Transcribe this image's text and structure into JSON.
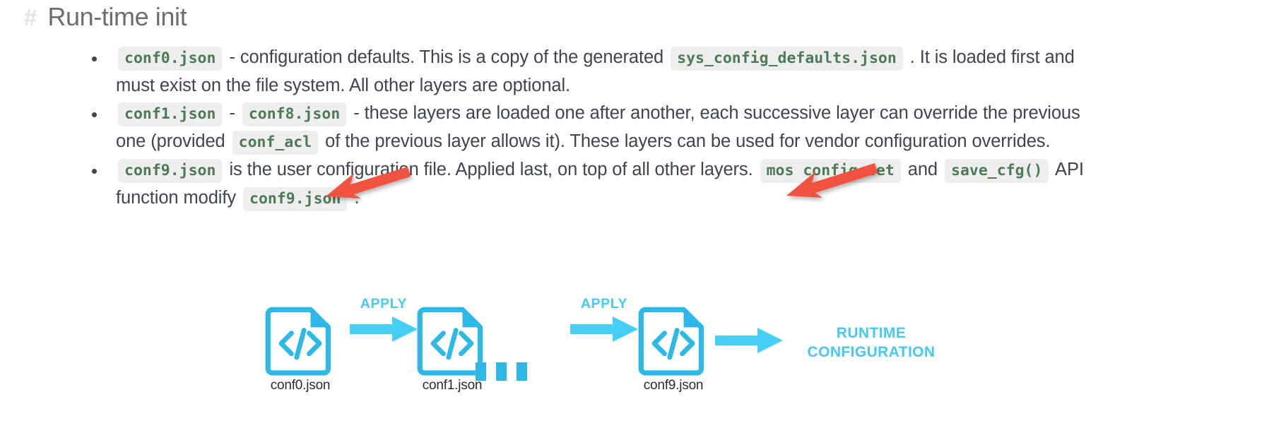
{
  "heading": {
    "anchor": "#",
    "title": "Run-time init"
  },
  "bullets": [
    {
      "id": "bullet-conf0",
      "parts": [
        {
          "type": "code",
          "text": "conf0.json"
        },
        {
          "type": "text",
          "text": " - configuration defaults. This is a copy of the generated "
        },
        {
          "type": "code",
          "text": "sys_config_defaults.json"
        },
        {
          "type": "text",
          "text": " . It is loaded first and must exist on the file system. All other layers are optional."
        }
      ]
    },
    {
      "id": "bullet-conf1-conf8",
      "parts": [
        {
          "type": "code",
          "text": "conf1.json"
        },
        {
          "type": "text",
          "text": " - "
        },
        {
          "type": "code",
          "text": "conf8.json"
        },
        {
          "type": "text",
          "text": " - these layers are loaded one after another, each successive layer can override the previous one (provided "
        },
        {
          "type": "code",
          "text": "conf_acl"
        },
        {
          "type": "text",
          "text": " of the previous layer allows it). These layers can be used for vendor configuration overrides."
        }
      ]
    },
    {
      "id": "bullet-conf9",
      "parts": [
        {
          "type": "code",
          "text": "conf9.json"
        },
        {
          "type": "text",
          "text": " is the user configuration file. Applied last, on top of all other layers. "
        },
        {
          "type": "code",
          "text": "mos config-set"
        },
        {
          "type": "text",
          "text": " and "
        },
        {
          "type": "code",
          "text": "save_cfg()"
        },
        {
          "type": "text",
          "text": " API function modify "
        },
        {
          "type": "code",
          "text": "conf9.json"
        },
        {
          "type": "text",
          "text": " ."
        }
      ]
    }
  ],
  "annotations": [
    {
      "id": "annotation-arrow-left",
      "color": "#F2523F",
      "points_to": "configuration-overrides-line"
    },
    {
      "id": "annotation-arrow-right",
      "color": "#F2523F",
      "points_to": "all-other-layers-phrase"
    }
  ],
  "diagram": {
    "nodes": [
      {
        "id": "node-conf0",
        "label": "conf0.json",
        "icon": "code-file-icon"
      },
      {
        "id": "node-conf1",
        "label": "conf1.json",
        "icon": "code-file-icon"
      },
      {
        "id": "node-conf9",
        "label": "conf9.json",
        "icon": "code-file-icon"
      }
    ],
    "apply_labels": [
      "APPLY",
      "APPLY"
    ],
    "ellipsis": "...",
    "result_label": "RUNTIME\nCONFIGURATION",
    "colors": {
      "icon": "#2eb8e8",
      "arrow": "#45cff5",
      "apply_text": "#45c8f2",
      "result_text": "#45c8f2"
    }
  },
  "colors": {
    "code_text": "#4b7c55",
    "code_bg": "#eeeeee",
    "body_text": "#3f4450",
    "heading_text": "#6a6d72",
    "anchor": "#e3e3e3",
    "annotation_red": "#F2523F"
  }
}
